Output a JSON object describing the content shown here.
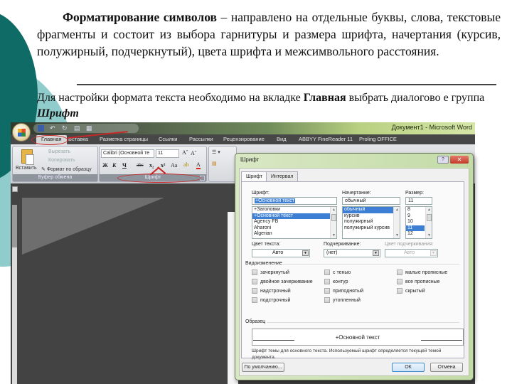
{
  "slide": {
    "para1_bold": "Форматирование символов",
    "para1_rest": " – направлено на отдельные буквы, слова, текстовые фрагменты и состоит из выбора гарнитуры и размера шрифта, начертания (курсив, полужирный, подчеркнутый), цвета шрифта и межсимвольного расстояния.",
    "para2_start": "Для настройки формата текста необходимо на вкладке ",
    "para2_bold": "Главная",
    "para2_mid": " выбрать диалогово е группа ",
    "para2_bolditalic": "Шрифт",
    "accent_dark": "#0f6b66",
    "accent_light": "#8fcccb"
  },
  "word": {
    "window_title": "Документ1 - Microsoft Word",
    "quick_access": [
      "save-icon",
      "undo-icon",
      "redo-icon",
      "print-icon",
      "preview-icon"
    ],
    "tabs": [
      "Главная",
      "Вставка",
      "Разметка страницы",
      "Ссылки",
      "Рассылки",
      "Рецензирование",
      "Вид",
      "ABBYY FineReader 11",
      "Proling OFFICE"
    ],
    "active_tab": "Главная",
    "clipboard": {
      "paste": "Вставить",
      "cut": "Вырезать",
      "copy": "Копировать",
      "format_painter": "Формат по образцу",
      "group_label": "Буфер обмена"
    },
    "font_group": {
      "font_name": "Calibri (Основной те",
      "font_size": "11",
      "grow": "Aˆ",
      "shrink": "Aˇ",
      "bold": "Ж",
      "italic": "К",
      "underline": "Ч",
      "strike": "abc",
      "subscript": "x₂",
      "superscript": "x²",
      "change_case": "Aa",
      "group_label": "Шрифт"
    }
  },
  "dialog": {
    "title": "Шрифт",
    "help": "?",
    "close": "✕",
    "tabs": [
      "Шрифт",
      "Интервал"
    ],
    "font_label": "Шрифт:",
    "font_value": "+Основной текст",
    "font_list": [
      "+Заголовки",
      "+Основной текст",
      "Agency FB",
      "Aharoni",
      "Algerian"
    ],
    "font_selected": 1,
    "style_label": "Начертание:",
    "style_value": "обычный",
    "style_list": [
      "обычный",
      "курсив",
      "полужирный",
      "полужирный курсив"
    ],
    "style_selected": 0,
    "size_label": "Размер:",
    "size_value": "11",
    "size_list": [
      "8",
      "9",
      "10",
      "11",
      "12"
    ],
    "size_selected": 3,
    "text_color_label": "Цвет текста:",
    "text_color_value": "Авто",
    "underline_label": "Подчеркивание:",
    "underline_value": "(нет)",
    "underline_color_label": "Цвет подчеркивания:",
    "underline_color_value": "Авто",
    "effects_label": "Видоизменение",
    "effects": [
      [
        "зачеркнутый",
        "двойное зачеркивание",
        "надстрочный",
        "подстрочный"
      ],
      [
        "с тенью",
        "контур",
        "приподнятый",
        "утопленный"
      ],
      [
        "малые прописные",
        "все прописные",
        "скрытый"
      ]
    ],
    "preview_label": "Образец",
    "preview_text": "+Основной текст",
    "description": "Шрифт темы для основного текста. Используемый шрифт определяется текущей темой документа.",
    "default_button": "По умолчанию...",
    "ok_button": "ОК",
    "cancel_button": "Отмена"
  }
}
